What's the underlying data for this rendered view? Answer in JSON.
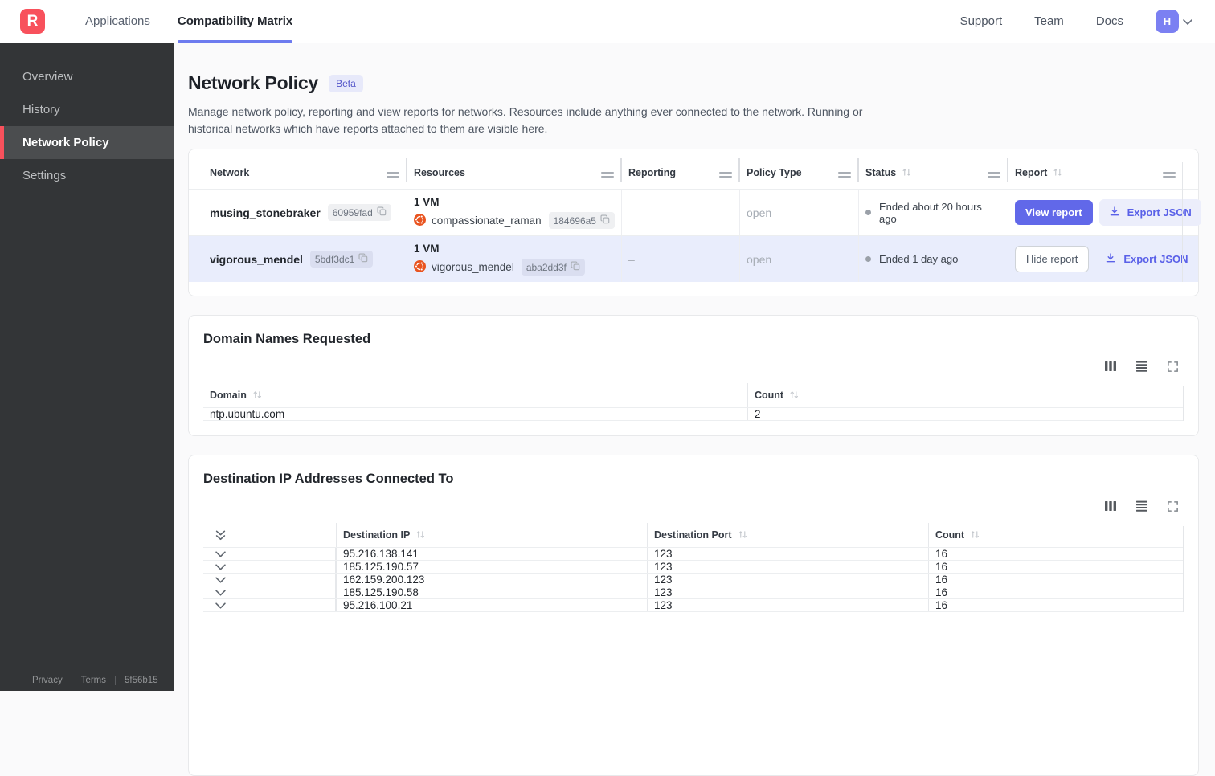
{
  "topbar": {
    "logo_letter": "R",
    "tabs": [
      {
        "label": "Applications"
      },
      {
        "label": "Compatibility Matrix"
      }
    ],
    "links": [
      {
        "label": "Support"
      },
      {
        "label": "Team"
      },
      {
        "label": "Docs"
      }
    ],
    "avatar_letter": "H"
  },
  "sidebar": {
    "items": [
      {
        "label": "Overview"
      },
      {
        "label": "History"
      },
      {
        "label": "Network Policy"
      },
      {
        "label": "Settings"
      }
    ],
    "footer": {
      "privacy": "Privacy",
      "terms": "Terms",
      "build": "5f56b15"
    }
  },
  "page": {
    "title": "Network Policy",
    "beta_badge": "Beta",
    "description": "Manage network policy, reporting and view reports for networks. Resources include anything ever connected to the network. Running or historical networks which have reports attached to them are visible here."
  },
  "networks_table": {
    "columns": {
      "network": "Network",
      "resources": "Resources",
      "reporting": "Reporting",
      "policy_type": "Policy Type",
      "status": "Status",
      "report": "Report"
    },
    "rows": [
      {
        "network_name": "musing_stonebraker",
        "network_id": "60959fad",
        "vm_count": "1 VM",
        "resource_name": "compassionate_raman",
        "resource_id": "184696a5",
        "reporting": "–",
        "policy_type": "open",
        "status": "Ended about 20 hours ago",
        "report_action": "View report",
        "export_action": "Export JSON"
      },
      {
        "network_name": "vigorous_mendel",
        "network_id": "5bdf3dc1",
        "vm_count": "1 VM",
        "resource_name": "vigorous_mendel",
        "resource_id": "aba2dd3f",
        "reporting": "–",
        "policy_type": "open",
        "status": "Ended 1 day ago",
        "report_action": "Hide report",
        "export_action": "Export JSON"
      }
    ]
  },
  "domains_card": {
    "title": "Domain Names Requested",
    "columns": {
      "domain": "Domain",
      "count": "Count"
    },
    "rows": [
      {
        "domain": "ntp.ubuntu.com",
        "count": "2"
      }
    ]
  },
  "destinations_card": {
    "title": "Destination IP Addresses Connected To",
    "columns": {
      "ip": "Destination IP",
      "port": "Destination Port",
      "count": "Count"
    },
    "rows": [
      {
        "ip": "95.216.138.141",
        "port": "123",
        "count": "16"
      },
      {
        "ip": "185.125.190.57",
        "port": "123",
        "count": "16"
      },
      {
        "ip": "162.159.200.123",
        "port": "123",
        "count": "16"
      },
      {
        "ip": "185.125.190.58",
        "port": "123",
        "count": "16"
      },
      {
        "ip": "95.216.100.21",
        "port": "123",
        "count": "16"
      }
    ]
  },
  "colors": {
    "brand_red": "#f8515c",
    "accent_indigo": "#6168e9",
    "selected_row_bg": "#e9edfc",
    "ubuntu_orange": "#e95420"
  }
}
